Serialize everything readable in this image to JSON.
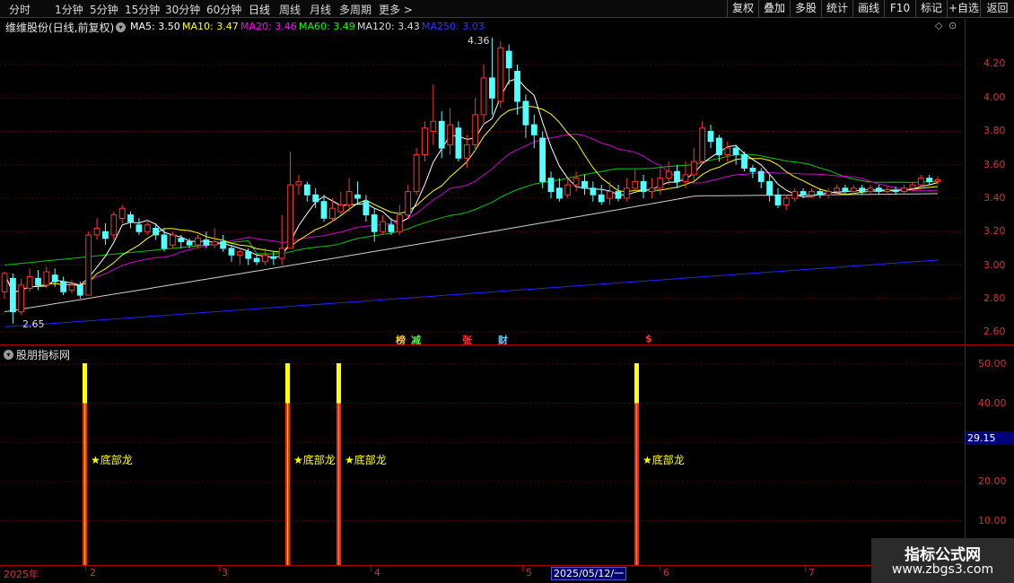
{
  "toolbar": {
    "timeframes": [
      "分时",
      "1分钟",
      "5分钟",
      "15分钟",
      "30分钟",
      "60分钟",
      "日线",
      "周线",
      "月线",
      "多周期",
      "更多 >"
    ],
    "active_timeframe": "日线",
    "buttons": [
      "复权",
      "叠加",
      "多股",
      "统计",
      "画线",
      "F10",
      "标记",
      "+自选",
      "返回"
    ]
  },
  "chart_header": {
    "stock_title": "维维股份(日线,前复权)",
    "ma": [
      {
        "label": "MA5: 3.50",
        "color": "#ffffff"
      },
      {
        "label": "MA10: 3.47",
        "color": "#ffff00"
      },
      {
        "label": "MA20: 3.46",
        "color": "#ff00ff"
      },
      {
        "label": "MA60: 3.49",
        "color": "#00ff00"
      },
      {
        "label": "MA120: 3.43",
        "color": "#dddddd"
      },
      {
        "label": "MA250: 3.03",
        "color": "#3333ff"
      }
    ]
  },
  "price_axis": [
    "4.20",
    "4.00",
    "3.80",
    "3.60",
    "3.40",
    "3.20",
    "3.00",
    "2.80",
    "2.60"
  ],
  "annotations": {
    "high": "4.36",
    "low": "2.65"
  },
  "events": [
    {
      "text": "榜",
      "color": "#ffcc00"
    },
    {
      "text": "减",
      "color": "#33ff33"
    },
    {
      "text": "张",
      "color": "#ff3333"
    },
    {
      "text": "财",
      "color": "#66ccff"
    },
    {
      "text": "$",
      "color": "#ff3333"
    }
  ],
  "indicator": {
    "title": "股朋指标网",
    "axis": [
      "50.00",
      "40.00",
      "20.00",
      "10.00"
    ],
    "current_value": "29.15",
    "signal_label": "★底部龙",
    "signals": [
      {
        "label": "★底部龙",
        "value": 50
      },
      {
        "label": "★底部龙",
        "value": 50
      },
      {
        "label": "★底部龙",
        "value": 50
      },
      {
        "label": "★底部龙",
        "value": 50
      }
    ]
  },
  "date_axis": {
    "labels": [
      "2025年",
      "2",
      "3",
      "4",
      "5",
      "6",
      "7"
    ],
    "cursor": "2025/05/12/一"
  },
  "watermark": {
    "line1": "指标公式网",
    "line2": "www.zbgs3.com"
  },
  "chart_data": {
    "type": "candlestick",
    "y_range": [
      2.55,
      4.45
    ],
    "price_ticks": [
      4.2,
      4.0,
      3.8,
      3.6,
      3.4,
      3.2,
      3.0,
      2.8,
      2.6
    ],
    "candles": [
      [
        2.84,
        2.95,
        2.8,
        2.96
      ],
      [
        2.92,
        2.72,
        2.65,
        2.95
      ],
      [
        2.72,
        2.88,
        2.7,
        2.92
      ],
      [
        2.86,
        2.93,
        2.84,
        2.98
      ],
      [
        2.92,
        2.88,
        2.85,
        2.97
      ],
      [
        2.88,
        2.96,
        2.86,
        2.99
      ],
      [
        2.94,
        2.9,
        2.87,
        2.98
      ],
      [
        2.9,
        2.84,
        2.82,
        2.93
      ],
      [
        2.85,
        2.88,
        2.83,
        2.91
      ],
      [
        2.88,
        2.82,
        2.8,
        2.9
      ],
      [
        2.82,
        3.18,
        2.82,
        3.2
      ],
      [
        3.18,
        3.22,
        3.15,
        3.28
      ],
      [
        3.2,
        3.16,
        3.12,
        3.25
      ],
      [
        3.18,
        3.3,
        3.15,
        3.32
      ],
      [
        3.28,
        3.34,
        3.25,
        3.36
      ],
      [
        3.3,
        3.26,
        3.22,
        3.32
      ],
      [
        3.24,
        3.2,
        3.18,
        3.28
      ],
      [
        3.2,
        3.24,
        3.18,
        3.26
      ],
      [
        3.22,
        3.18,
        3.15,
        3.25
      ],
      [
        3.18,
        3.1,
        3.08,
        3.22
      ],
      [
        3.12,
        3.18,
        3.1,
        3.2
      ],
      [
        3.16,
        3.14,
        3.1,
        3.18
      ],
      [
        3.14,
        3.12,
        3.1,
        3.16
      ],
      [
        3.12,
        3.16,
        3.1,
        3.18
      ],
      [
        3.15,
        3.12,
        3.1,
        3.2
      ],
      [
        3.12,
        3.14,
        3.1,
        3.22
      ],
      [
        3.14,
        3.1,
        3.08,
        3.18
      ],
      [
        3.1,
        3.06,
        3.02,
        3.12
      ],
      [
        3.06,
        3.08,
        3.0,
        3.1
      ],
      [
        3.08,
        3.04,
        3.0,
        3.1
      ],
      [
        3.04,
        3.02,
        3.0,
        3.06
      ],
      [
        3.02,
        3.06,
        3.0,
        3.1
      ],
      [
        3.05,
        3.04,
        3.0,
        3.08
      ],
      [
        3.04,
        3.1,
        3.0,
        3.3
      ],
      [
        3.1,
        3.48,
        3.1,
        3.68
      ],
      [
        3.48,
        3.5,
        3.42,
        3.54
      ],
      [
        3.48,
        3.42,
        3.38,
        3.5
      ],
      [
        3.42,
        3.38,
        3.34,
        3.46
      ],
      [
        3.38,
        3.28,
        3.26,
        3.42
      ],
      [
        3.28,
        3.34,
        3.26,
        3.4
      ],
      [
        3.32,
        3.36,
        3.3,
        3.44
      ],
      [
        3.36,
        3.44,
        3.32,
        3.52
      ],
      [
        3.42,
        3.4,
        3.36,
        3.5
      ],
      [
        3.38,
        3.3,
        3.26,
        3.42
      ],
      [
        3.3,
        3.2,
        3.14,
        3.34
      ],
      [
        3.2,
        3.26,
        3.18,
        3.3
      ],
      [
        3.24,
        3.2,
        3.18,
        3.28
      ],
      [
        3.2,
        3.3,
        3.18,
        3.36
      ],
      [
        3.3,
        3.44,
        3.28,
        3.48
      ],
      [
        3.44,
        3.66,
        3.42,
        3.7
      ],
      [
        3.66,
        3.82,
        3.62,
        3.86
      ],
      [
        3.8,
        3.86,
        3.72,
        4.08
      ],
      [
        3.86,
        3.7,
        3.64,
        3.92
      ],
      [
        3.72,
        3.84,
        3.66,
        3.94
      ],
      [
        3.82,
        3.64,
        3.62,
        3.86
      ],
      [
        3.64,
        3.72,
        3.58,
        3.78
      ],
      [
        3.72,
        3.9,
        3.68,
        4.0
      ],
      [
        3.9,
        4.12,
        3.84,
        4.2
      ],
      [
        4.12,
        4.0,
        3.9,
        4.36
      ],
      [
        3.98,
        4.3,
        3.94,
        4.34
      ],
      [
        4.28,
        4.18,
        4.08,
        4.32
      ],
      [
        4.16,
        3.98,
        3.9,
        4.2
      ],
      [
        3.98,
        3.84,
        3.76,
        4.02
      ],
      [
        3.84,
        3.78,
        3.7,
        3.9
      ],
      [
        3.76,
        3.5,
        3.46,
        3.8
      ],
      [
        3.52,
        3.44,
        3.4,
        3.56
      ],
      [
        3.46,
        3.4,
        3.38,
        3.52
      ],
      [
        3.42,
        3.48,
        3.4,
        3.52
      ],
      [
        3.48,
        3.52,
        3.44,
        3.56
      ],
      [
        3.5,
        3.46,
        3.42,
        3.54
      ],
      [
        3.46,
        3.42,
        3.38,
        3.5
      ],
      [
        3.42,
        3.38,
        3.36,
        3.48
      ],
      [
        3.4,
        3.44,
        3.36,
        3.5
      ],
      [
        3.44,
        3.4,
        3.38,
        3.48
      ],
      [
        3.4,
        3.46,
        3.38,
        3.52
      ],
      [
        3.46,
        3.5,
        3.44,
        3.58
      ],
      [
        3.5,
        3.44,
        3.4,
        3.54
      ],
      [
        3.44,
        3.46,
        3.4,
        3.52
      ],
      [
        3.46,
        3.52,
        3.42,
        3.58
      ],
      [
        3.52,
        3.56,
        3.48,
        3.62
      ],
      [
        3.56,
        3.5,
        3.46,
        3.6
      ],
      [
        3.5,
        3.54,
        3.46,
        3.62
      ],
      [
        3.54,
        3.62,
        3.5,
        3.7
      ],
      [
        3.62,
        3.82,
        3.6,
        3.86
      ],
      [
        3.8,
        3.74,
        3.7,
        3.84
      ],
      [
        3.76,
        3.66,
        3.62,
        3.78
      ],
      [
        3.66,
        3.7,
        3.62,
        3.74
      ],
      [
        3.7,
        3.66,
        3.6,
        3.72
      ],
      [
        3.66,
        3.58,
        3.56,
        3.68
      ],
      [
        3.58,
        3.56,
        3.52,
        3.6
      ],
      [
        3.56,
        3.5,
        3.46,
        3.58
      ],
      [
        3.5,
        3.42,
        3.38,
        3.54
      ],
      [
        3.42,
        3.36,
        3.34,
        3.46
      ],
      [
        3.36,
        3.4,
        3.33,
        3.42
      ],
      [
        3.4,
        3.44,
        3.38,
        3.46
      ],
      [
        3.44,
        3.42,
        3.4,
        3.46
      ],
      [
        3.42,
        3.44,
        3.4,
        3.46
      ],
      [
        3.44,
        3.42,
        3.4,
        3.46
      ],
      [
        3.42,
        3.44,
        3.4,
        3.46
      ],
      [
        3.44,
        3.46,
        3.42,
        3.48
      ],
      [
        3.46,
        3.44,
        3.42,
        3.48
      ],
      [
        3.44,
        3.46,
        3.42,
        3.48
      ],
      [
        3.46,
        3.44,
        3.42,
        3.48
      ],
      [
        3.44,
        3.46,
        3.42,
        3.48
      ],
      [
        3.46,
        3.44,
        3.42,
        3.48
      ],
      [
        3.44,
        3.45,
        3.42,
        3.47
      ],
      [
        3.45,
        3.44,
        3.42,
        3.47
      ],
      [
        3.44,
        3.46,
        3.43,
        3.48
      ],
      [
        3.46,
        3.48,
        3.44,
        3.5
      ],
      [
        3.48,
        3.52,
        3.46,
        3.54
      ],
      [
        3.52,
        3.5,
        3.48,
        3.54
      ],
      [
        3.5,
        3.51,
        3.48,
        3.53
      ]
    ]
  }
}
